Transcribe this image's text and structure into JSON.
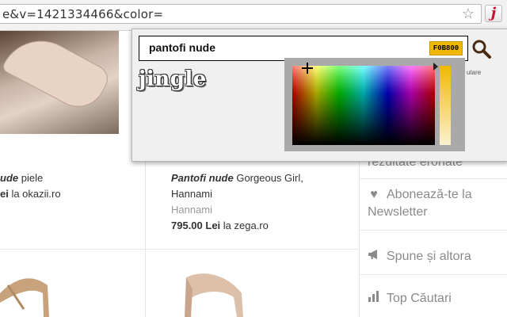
{
  "browser": {
    "url": "e&v=1421334466&color=",
    "star_icon": "star-icon",
    "extension_icon": "jingle-extension-icon",
    "extension_letter": "j"
  },
  "products": [
    {
      "name_em": "ude",
      "name_rest": " piele",
      "price": "ei",
      "store": " la okazii.ro"
    },
    {
      "name_em": "Pantofi nude",
      "name_rest": " Gorgeous Girl,",
      "name_line2": "Hannami",
      "brand": "Hannami",
      "price": "795.00 Lei",
      "store": " la zega.ro"
    }
  ],
  "sidebar": {
    "items": [
      {
        "label": "rezultate eronate",
        "icon": ""
      },
      {
        "label": "Abonează-te la Newsletter",
        "icon": "heart-icon"
      },
      {
        "label": "Spune și altora",
        "icon": "megaphone-icon"
      },
      {
        "label": "Top Căutari",
        "icon": "bar-chart-icon"
      }
    ]
  },
  "popup": {
    "search_value": "pantofi nude",
    "color_value": "F0B800",
    "logo_text": "jingle",
    "hint_text": "utare",
    "colors": {
      "selected": "#f0b800"
    }
  }
}
